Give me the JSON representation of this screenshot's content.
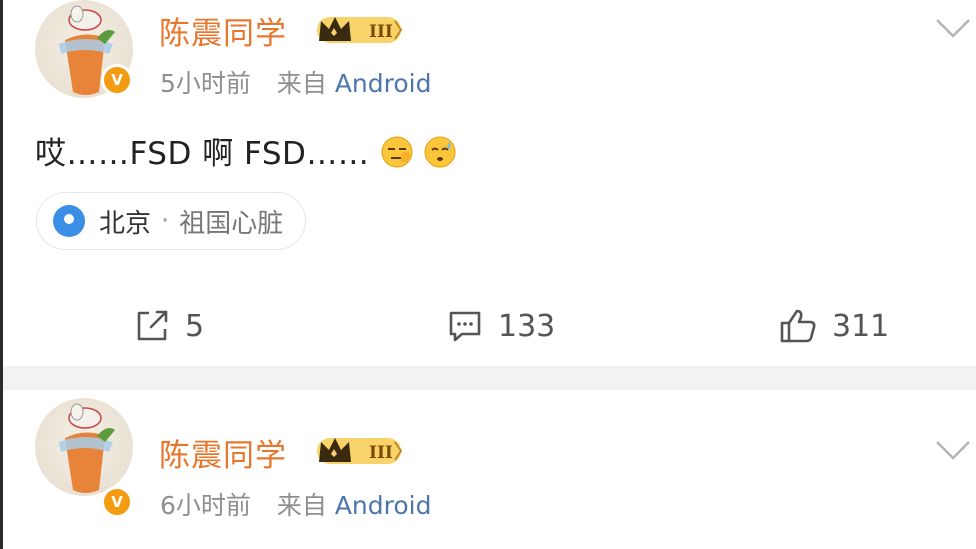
{
  "posts": [
    {
      "username": "陈震同学",
      "time": "5小时前",
      "source_prefix": "来自",
      "source": "Android",
      "content": "哎……FSD 啊 FSD……",
      "location": {
        "city": "北京",
        "sep": "·",
        "desc": "祖国心脏"
      },
      "actions": {
        "repost": "5",
        "comment": "133",
        "like": "311"
      }
    },
    {
      "username": "陈震同学",
      "time": "6小时前",
      "source_prefix": "来自",
      "source": "Android"
    }
  ],
  "colors": {
    "username": "#e8772e",
    "source": "#4d76ad",
    "meta": "#8f8f8f",
    "badge": "#f39c12"
  },
  "icons": [
    "chevron-down-icon",
    "crown-rank-icon",
    "location-pin-icon",
    "repost-icon",
    "comment-icon",
    "like-icon"
  ]
}
